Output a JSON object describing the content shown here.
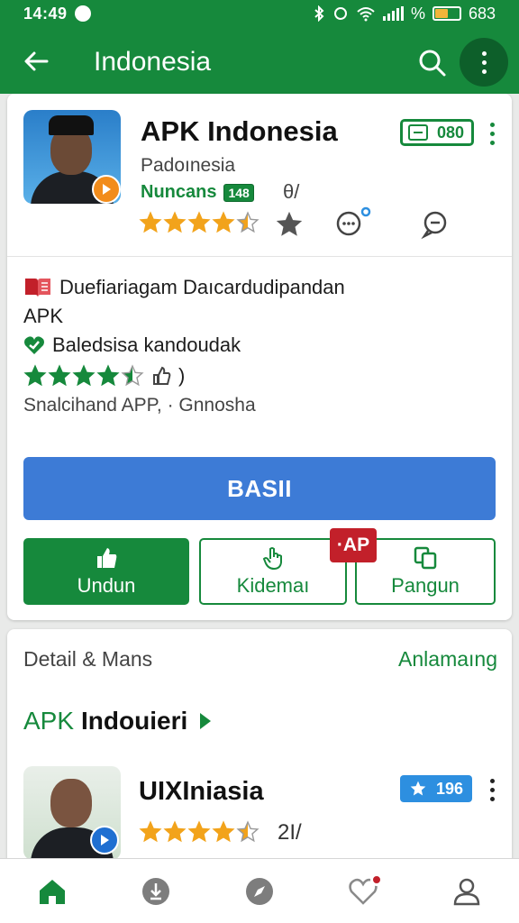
{
  "status_bar": {
    "time": "14:49",
    "battery_text": "683",
    "battery_symbol": "%",
    "battery_level": 0.55
  },
  "app_bar": {
    "title": "Indonesia"
  },
  "featured": {
    "name": "APK Indonesia",
    "developer": "Padoınesia",
    "category": "Nuncans",
    "category_badge": "148",
    "extra_symbol": "θ/",
    "rating": 4.5,
    "count_badge": "080"
  },
  "details": {
    "line1": "Duefiariagam Daıcardudipandan",
    "line2": "APK",
    "line3": "Baledsisa kandoudak",
    "rating": 4.5,
    "rating_suffix": ")",
    "line4": "Snalcihand APP, · Gnnosha"
  },
  "primary_button": {
    "label": "BASII"
  },
  "action_buttons": [
    {
      "label": "Undun"
    },
    {
      "label": "Kidemaı"
    },
    {
      "label": "Pangun"
    }
  ],
  "ap_badge": "·AP",
  "section": {
    "title": "Detail & Mans",
    "link": "Anlamaıng",
    "heading_green": "APK",
    "heading_bold": "Indouieri"
  },
  "second_app": {
    "name": "UIXIniasia",
    "count_badge": "196",
    "rating": 4.5,
    "extra_symbol": "2I/"
  },
  "colors": {
    "primary": "#16893c",
    "accent_blue": "#3d7bd6",
    "star": "#f2a31b",
    "badge_red": "#c2202a"
  },
  "bottom_nav": [
    "home-icon",
    "download-icon",
    "explore-icon",
    "favorites-icon",
    "profile-icon"
  ]
}
